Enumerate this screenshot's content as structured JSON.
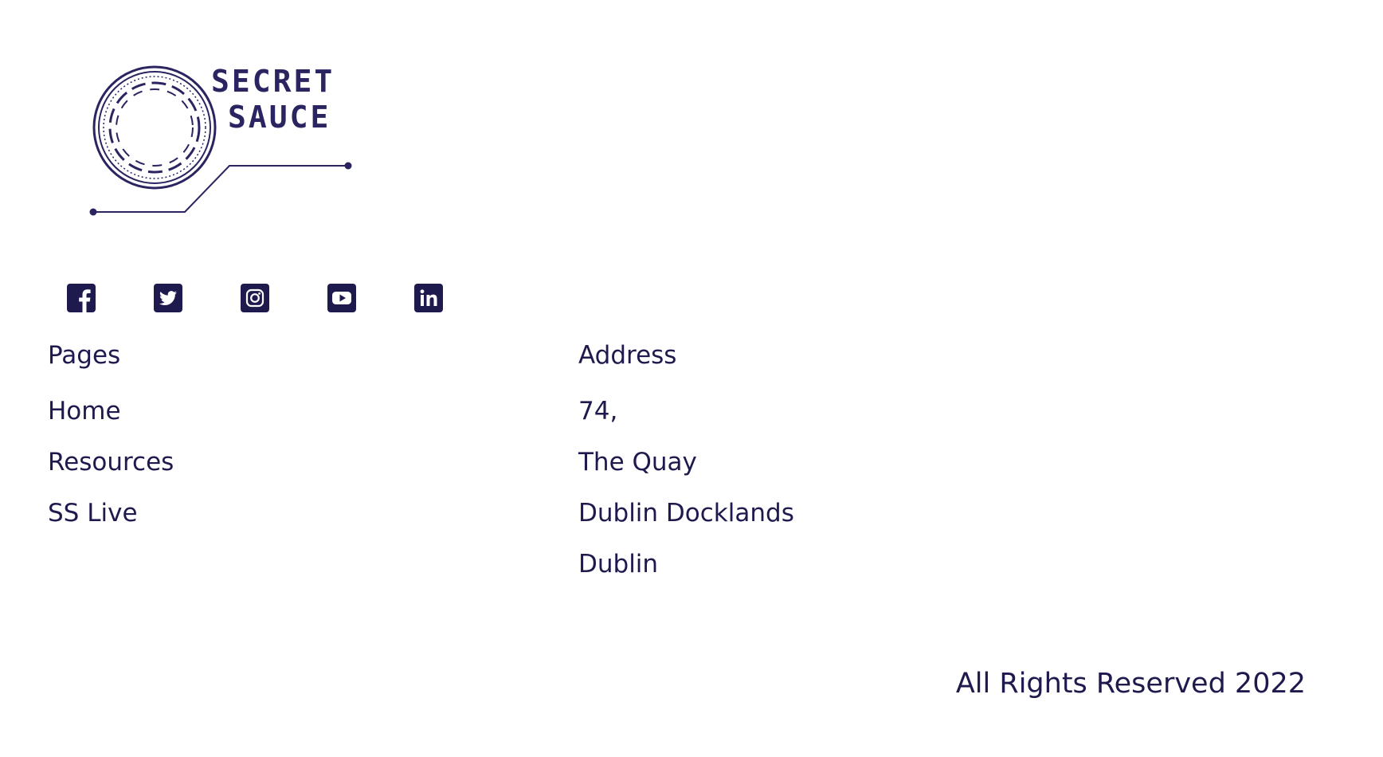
{
  "logo": {
    "name": "secret-sauce-logo",
    "lines": [
      "SECRET",
      "SAUCE"
    ]
  },
  "social_icons": [
    {
      "icon": "facebook-icon"
    },
    {
      "icon": "twitter-icon"
    },
    {
      "icon": "instagram-icon"
    },
    {
      "icon": "youtube-icon"
    },
    {
      "icon": "linkedin-icon"
    }
  ],
  "pages": {
    "title": "Pages",
    "items": [
      "Home",
      "Resources",
      "SS Live"
    ]
  },
  "address": {
    "title": "Address",
    "lines": [
      "74,",
      "The Quay",
      "Dublin Docklands",
      "Dublin"
    ]
  },
  "footer": {
    "copyright": "All Rights Reserved 2022"
  },
  "colors": {
    "brand": "#1f1a4e"
  }
}
